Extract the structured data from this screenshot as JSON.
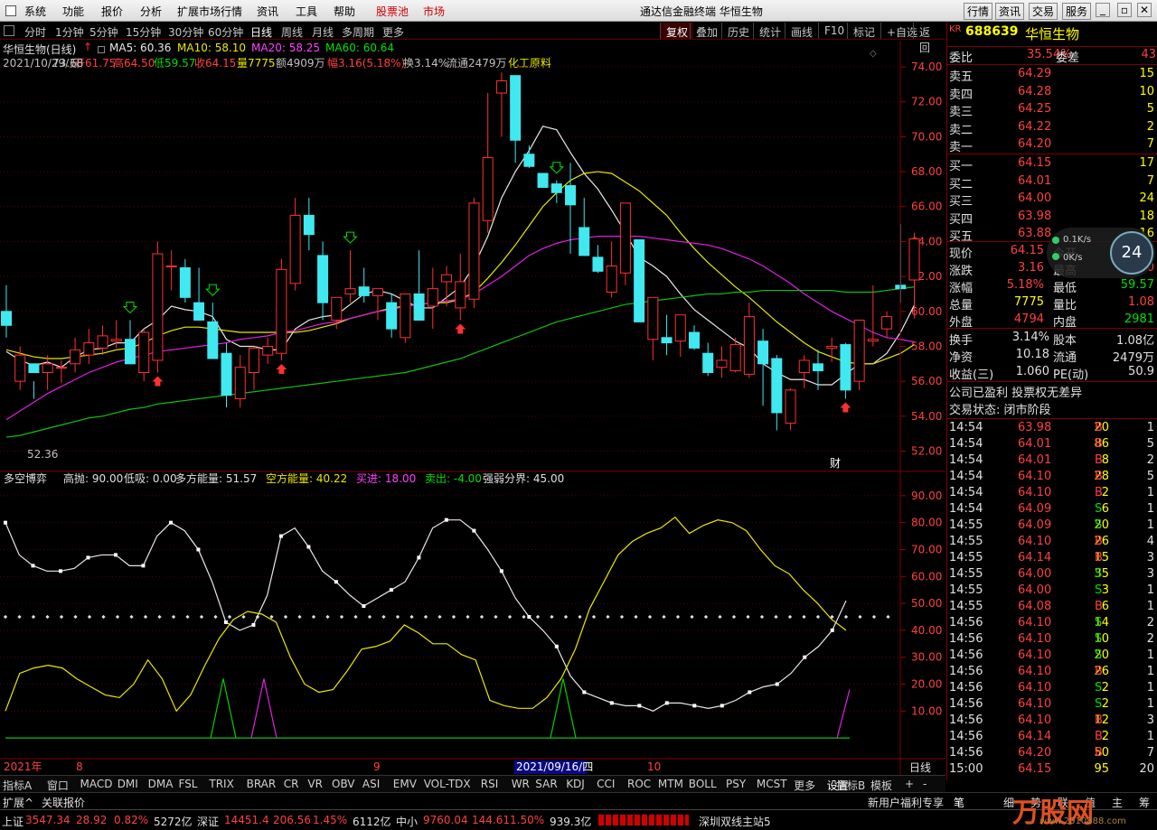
{
  "menu": {
    "items": [
      "系统",
      "功能",
      "报价",
      "分析",
      "扩展市场行情",
      "资讯",
      "工具",
      "帮助"
    ],
    "stockpool": "股票池",
    "market": "市场",
    "title": "通达信金融终端 华恒生物",
    "right_buttons": [
      "行情",
      "资讯",
      "交易",
      "服务"
    ]
  },
  "periods": {
    "items": [
      "分时",
      "1分钟",
      "5分钟",
      "15分钟",
      "30分钟",
      "60分钟",
      "日线",
      "周线",
      "月线",
      "多周期",
      "更多"
    ],
    "active": "日线",
    "right": [
      "复权",
      "叠加",
      "历史",
      "统计",
      "画线",
      "F10",
      "标记",
      "+自选",
      "返回"
    ]
  },
  "info": {
    "name": "华恒生物(日线)",
    "ma5": "MA5: 60.36",
    "ma10": "MA10: 58.10",
    "ma20": "MA20: 58.25",
    "ma60": "MA60: 60.64",
    "date": "2021/10/29/五",
    "open": "开61.75",
    "high": "高64.50",
    "low": "低59.57",
    "close": "收64.15",
    "vol": "量7775",
    "amt": "额4909万",
    "amp": "幅3.16(5.18%)",
    "turn": "换3.14%",
    "float": "流通2479万",
    "industry": "化工原料"
  },
  "indicator": {
    "name": "多空博弈",
    "gp": "高抛: 90.00",
    "dx": "低吸: 0.00",
    "dfnl": "多方能量: 51.57",
    "kfnl": "空方能量: 40.22",
    "mj": "买进: 18.00",
    "mc": "卖出: -4.00",
    "qrfj": "强弱分界: 45.00"
  },
  "price_axis": [
    "74.00",
    "72.00",
    "70.00",
    "68.00",
    "66.00",
    "64.00",
    "62.00",
    "60.00",
    "58.00",
    "56.00",
    "54.00",
    "52.00"
  ],
  "ind_axis": [
    "90.00",
    "80.00",
    "70.00",
    "60.00",
    "50.00",
    "40.00",
    "30.00",
    "20.00",
    "10.00"
  ],
  "annot": {
    "max": "73.68",
    "min": "52.36",
    "cai": "财"
  },
  "date_axis": {
    "y2021": "2021年",
    "m8": "8",
    "m9": "9",
    "sel": "2021/09/16/四",
    "m10": "10",
    "period": "日线"
  },
  "chart_data": {
    "type": "candlestick",
    "symbol": "688639",
    "name": "华恒生物",
    "candles": [
      [
        60,
        61.5,
        58.5,
        59.2
      ],
      [
        56,
        58,
        55.5,
        57.5
      ],
      [
        57,
        56,
        55,
        56.5
      ],
      [
        56.5,
        57.5,
        55.5,
        57
      ],
      [
        56.8,
        57.2,
        55.9,
        56.8
      ],
      [
        57,
        58.5,
        56.5,
        57.8
      ],
      [
        57.5,
        59,
        57,
        58.2
      ],
      [
        57.9,
        59.2,
        57.5,
        58.6
      ],
      [
        58.3,
        59.5,
        57.9,
        58.4
      ],
      [
        58.4,
        59.5,
        57.5,
        57
      ],
      [
        56.5,
        59,
        56,
        58.8
      ],
      [
        57.2,
        64,
        56.5,
        63.3
      ],
      [
        62.6,
        63.5,
        61.2,
        62.6
      ],
      [
        62.5,
        63,
        60.5,
        60.8
      ],
      [
        60.5,
        62.5,
        59.8,
        59.5
      ],
      [
        59.4,
        60.5,
        58.5,
        57.3
      ],
      [
        57.6,
        58.2,
        54.5,
        55.2
      ],
      [
        55,
        57.5,
        54.5,
        56.8
      ],
      [
        56.5,
        58,
        55.5,
        57.9
      ],
      [
        57.5,
        58.5,
        57,
        58
      ],
      [
        57.6,
        63,
        57.2,
        62.4
      ],
      [
        61.6,
        66.5,
        61.2,
        65.5
      ],
      [
        65.5,
        66.5,
        63.5,
        64.4
      ],
      [
        63.2,
        64,
        59.5,
        60.5
      ],
      [
        59.5,
        60.8,
        59,
        60.8
      ],
      [
        61,
        63.5,
        60.5,
        61.3
      ],
      [
        61.4,
        62.5,
        60.5,
        60.9
      ],
      [
        60.9,
        61.2,
        59.5,
        61.3
      ],
      [
        60.5,
        61,
        58.5,
        59
      ],
      [
        58.5,
        61,
        58.2,
        61
      ],
      [
        61,
        63.5,
        59.5,
        59.5
      ],
      [
        60.3,
        62.5,
        59,
        61.3
      ],
      [
        61.7,
        62.6,
        60.3,
        62.1
      ],
      [
        60.2,
        63.3,
        59.5,
        61.7
      ],
      [
        60.7,
        66.5,
        60.2,
        66.2
      ],
      [
        65.2,
        72.5,
        64.5,
        68.8
      ],
      [
        72.5,
        73.68,
        70,
        73.2
      ],
      [
        73.5,
        73.5,
        68.5,
        69.8
      ],
      [
        69,
        69.5,
        68.2,
        68.3
      ],
      [
        67.9,
        67.9,
        67.1,
        67.1
      ],
      [
        67.3,
        67.5,
        66.2,
        66.8
      ],
      [
        67.2,
        68.5,
        63.3,
        66.1
      ],
      [
        64.8,
        66.5,
        63.2,
        63.2
      ],
      [
        63.1,
        63.8,
        62.2,
        62.3
      ],
      [
        61.1,
        64,
        60.8,
        62.6
      ],
      [
        62.2,
        64.5,
        61.5,
        66.2
      ],
      [
        64.1,
        64.1,
        59.4,
        59.4
      ],
      [
        58.4,
        60.8,
        57.2,
        60.8
      ],
      [
        58.5,
        59.8,
        57.5,
        58.2
      ],
      [
        58.3,
        59.5,
        57.4,
        59.8
      ],
      [
        58.8,
        59.2,
        57.8,
        57.9
      ],
      [
        57.6,
        58.2,
        56.3,
        56.5
      ],
      [
        56.8,
        58,
        56.2,
        57.2
      ],
      [
        56.6,
        58.5,
        56.5,
        58.1
      ],
      [
        56.4,
        60.5,
        56.2,
        59.7
      ],
      [
        58.3,
        59,
        54.6,
        57
      ],
      [
        57.3,
        57.5,
        53.2,
        54.2
      ],
      [
        53.6,
        55.6,
        53.2,
        55.5
      ],
      [
        56.5,
        57.5,
        55.6,
        57.2
      ],
      [
        57,
        57.8,
        55.5,
        56.6
      ],
      [
        57.9,
        58.5,
        57.1,
        58
      ],
      [
        58.1,
        58.2,
        55,
        55.5
      ],
      [
        56,
        59.5,
        55.5,
        59.5
      ],
      [
        58.3,
        61.5,
        58,
        58.4
      ],
      [
        59,
        60,
        58.5,
        59.7
      ],
      [
        61.5,
        65,
        60.5,
        61.3
      ],
      [
        61.8,
        64.5,
        59.6,
        64.15
      ]
    ],
    "ma5": [
      57.7,
      57.2,
      56.9,
      57.1,
      56.8,
      57.4,
      57.8,
      57.9,
      58.2,
      58.2,
      59,
      59.5,
      60.3,
      60.1,
      60,
      59.7,
      58.4,
      58,
      58,
      57.8,
      57.8,
      59,
      59.5,
      59.7,
      59.8,
      60.4,
      61,
      61.2,
      61,
      60.6,
      60.2,
      60.2,
      60.8,
      61.4,
      62.6,
      64.3,
      66.5,
      68,
      69.2,
      70.6,
      70.4,
      69.1,
      67.9,
      67,
      65.8,
      64.5,
      63.1,
      62.6,
      62,
      61,
      60.1,
      59.5,
      58.9,
      58.3,
      57.9,
      57,
      56.5,
      56.1,
      56.1,
      55.8,
      55.8,
      56.4,
      57,
      57,
      57.6,
      58.8,
      60.36
    ],
    "ma10": [
      57.8,
      57.6,
      57.4,
      57.3,
      57.3,
      57.4,
      57.5,
      57.6,
      57.8,
      57.9,
      58.2,
      58.6,
      58.9,
      59.1,
      59.1,
      59,
      58.9,
      58.8,
      58.8,
      58.8,
      58.8,
      58.8,
      58.9,
      59.1,
      59.3,
      59.6,
      59.8,
      60,
      60.2,
      60.3,
      60.4,
      60.5,
      60.5,
      60.7,
      61.1,
      61.9,
      62.8,
      63.8,
      64.9,
      66,
      66.8,
      67.5,
      67.9,
      68,
      67.9,
      67.4,
      66.9,
      66.2,
      65.5,
      64.5,
      63.6,
      62.8,
      62.1,
      61.4,
      60.8,
      60.1,
      59.4,
      58.8,
      58.2,
      57.7,
      57.4,
      57.1,
      57,
      57,
      57.3,
      57.6,
      58.1
    ],
    "ma20": [
      53.8,
      54.3,
      54.8,
      55.3,
      55.7,
      56.1,
      56.5,
      56.8,
      57.1,
      57.3,
      57.5,
      57.7,
      57.8,
      57.9,
      58,
      58.1,
      58.2,
      58.4,
      58.5,
      58.6,
      58.8,
      58.9,
      59.1,
      59.3,
      59.4,
      59.6,
      59.8,
      60,
      60.1,
      60.3,
      60.4,
      60.5,
      60.6,
      60.7,
      61,
      61.5,
      62,
      62.6,
      63.2,
      63.6,
      63.9,
      64.1,
      64.2,
      64.3,
      64.3,
      64.3,
      64.3,
      64.2,
      64.1,
      64,
      63.9,
      63.8,
      63.6,
      63.3,
      63,
      62.6,
      62.1,
      61.6,
      61,
      60.5,
      60,
      59.6,
      59.2,
      58.8,
      58.5,
      58.4,
      58.25
    ],
    "ma60": [
      52.8,
      52.9,
      53.1,
      53.3,
      53.5,
      53.7,
      53.9,
      54,
      54.2,
      54.4,
      54.5,
      54.7,
      54.8,
      54.9,
      55,
      55.1,
      55.2,
      55.3,
      55.4,
      55.5,
      55.6,
      55.7,
      55.8,
      55.9,
      56,
      56.1,
      56.2,
      56.3,
      56.4,
      56.5,
      56.7,
      56.9,
      57.1,
      57.3,
      57.6,
      57.9,
      58.2,
      58.5,
      58.8,
      59.1,
      59.4,
      59.6,
      59.8,
      60,
      60.2,
      60.4,
      60.5,
      60.6,
      60.7,
      60.8,
      60.9,
      61,
      61,
      61.1,
      61.1,
      61.2,
      61.2,
      61.2,
      61.2,
      61.2,
      61.2,
      61.1,
      61.1,
      61.1,
      61.2,
      61.3,
      61.4
    ],
    "long": [
      80,
      68,
      64,
      62,
      62,
      63,
      67,
      68,
      68,
      64,
      64,
      75,
      80,
      77,
      70,
      58,
      43,
      40,
      42,
      53,
      75,
      78,
      71,
      62,
      58,
      53,
      49,
      52,
      55,
      58,
      67,
      78,
      81,
      81,
      77,
      70,
      62,
      52,
      45,
      40,
      34,
      23,
      17,
      15,
      13,
      12,
      12,
      10,
      13,
      13,
      12,
      11,
      12,
      14,
      17,
      19,
      20,
      24,
      30,
      34,
      40,
      51
    ],
    "short": [
      10,
      24,
      26,
      27,
      26,
      22,
      19,
      16,
      15,
      20,
      29,
      22,
      10,
      16,
      27,
      37,
      44,
      47,
      46,
      43,
      30,
      20,
      17,
      18,
      25,
      33,
      34,
      36,
      42,
      39,
      35,
      35,
      31,
      29,
      14,
      12,
      11,
      11,
      15,
      22,
      33,
      48,
      58,
      68,
      73,
      76,
      78,
      82,
      76,
      79,
      81,
      80,
      77,
      70,
      64,
      61,
      55,
      50,
      44,
      40
    ]
  },
  "quote": {
    "code": "688639",
    "name": "华恒生物",
    "wb_label": "委比",
    "wb": "35.54%",
    "wc_label": "委差",
    "wc": "43",
    "sells": [
      [
        "卖五",
        "64.29",
        "15"
      ],
      [
        "卖四",
        "64.28",
        "10"
      ],
      [
        "卖三",
        "64.25",
        "5"
      ],
      [
        "卖二",
        "64.22",
        "2"
      ],
      [
        "卖一",
        "64.20",
        "7"
      ]
    ],
    "buys": [
      [
        "买一",
        "64.15",
        "17"
      ],
      [
        "买二",
        "64.01",
        "7"
      ],
      [
        "买三",
        "64.00",
        "24"
      ],
      [
        "买四",
        "63.98",
        "18"
      ],
      [
        "买五",
        "63.88",
        "16"
      ]
    ],
    "stats": [
      [
        "现价",
        "64.15",
        "今开",
        "61.75"
      ],
      [
        "涨跌",
        "3.16",
        "最高",
        "64.50"
      ],
      [
        "涨幅",
        "5.18%",
        "最低",
        "59.57"
      ],
      [
        "总量",
        "7775",
        "量比",
        "1.08"
      ],
      [
        "外盘",
        "4794",
        "内盘",
        "2981"
      ]
    ],
    "stats2": [
      [
        "换手",
        "3.14%",
        "股本",
        "1.08亿"
      ],
      [
        "净资",
        "10.18",
        "流通",
        "2479万"
      ],
      [
        "收益(三)",
        "1.060",
        "PE(动)",
        "50.9"
      ]
    ],
    "profit": "公司已盈利 投票权无差异",
    "trade_state": "交易状态: 闭市阶段",
    "ticks": [
      [
        "14:54",
        "63.98",
        "20",
        "B",
        "1"
      ],
      [
        "14:54",
        "64.01",
        "86",
        "B",
        "5"
      ],
      [
        "14:54",
        "64.01",
        "8",
        "B",
        "2"
      ],
      [
        "14:54",
        "64.10",
        "28",
        "B",
        "5"
      ],
      [
        "14:54",
        "64.10",
        "2",
        "B",
        "1"
      ],
      [
        "14:54",
        "64.09",
        "6",
        "S",
        "1"
      ],
      [
        "14:55",
        "64.09",
        "20",
        "S",
        "1"
      ],
      [
        "14:55",
        "64.10",
        "26",
        "B",
        "4"
      ],
      [
        "14:55",
        "64.14",
        "15",
        "B",
        "3"
      ],
      [
        "14:55",
        "64.00",
        "35",
        "S",
        "3"
      ],
      [
        "14:55",
        "64.00",
        "3",
        "S",
        "1"
      ],
      [
        "14:55",
        "64.08",
        "6",
        "B",
        "1"
      ],
      [
        "14:56",
        "64.10",
        "14",
        "S",
        "2"
      ],
      [
        "14:56",
        "64.10",
        "10",
        "S",
        "2"
      ],
      [
        "14:56",
        "64.10",
        "20",
        "S",
        "1"
      ],
      [
        "14:56",
        "64.10",
        "26",
        "B",
        "1"
      ],
      [
        "14:56",
        "64.10",
        "2",
        "S",
        "1"
      ],
      [
        "14:56",
        "64.10",
        "2",
        "S",
        "1"
      ],
      [
        "14:56",
        "64.10",
        "12",
        "B",
        "3"
      ],
      [
        "14:56",
        "64.14",
        "2",
        "B",
        "1"
      ],
      [
        "14:56",
        "64.20",
        "50",
        "B",
        "7"
      ],
      [
        "15:00",
        "64.15",
        "95",
        "",
        "20"
      ]
    ],
    "speed1": "0.1K/s",
    "speed2": "0K/s",
    "pct": "24"
  },
  "tabs": {
    "items": [
      "指标A",
      "窗口",
      "MACD",
      "DMI",
      "DMA",
      "FSL",
      "TRIX",
      "BRAR",
      "CR",
      "VR",
      "OBV",
      "ASI",
      "EMV",
      "VOL-TDX",
      "RSI",
      "WR",
      "SAR",
      "KDJ",
      "CCI",
      "ROC",
      "MTM",
      "BOLL",
      "PSY",
      "MCST",
      "更多",
      "设置"
    ],
    "right": [
      "指标B",
      "模板",
      "+",
      "-"
    ]
  },
  "bot2": {
    "a": "扩展^",
    "b": "关联报价",
    "c": "新用户福利专享",
    "d": "笔",
    "e": "细",
    "f": "势",
    "g": "联",
    "h": "值",
    "i": "主",
    "j": "筹"
  },
  "status": {
    "sh": "上证",
    "sh_val": "3547.34",
    "sh_ch": "28.92",
    "sh_pct": "0.82%",
    "sh_amt": "5272亿",
    "sz": "深证",
    "sz_val": "14451.4",
    "sz_ch": "206.56",
    "sz_pct": "1.45%",
    "sz_amt": "6112亿",
    "zx": "中小",
    "zx_val": "9760.04",
    "zx_ch": "144.61",
    "zx_pct": "1.50%",
    "zx_amt": "939.3亿",
    "server": "深圳双线主站5",
    "wm": "万股网",
    "wm_url": "www.2010888.com"
  }
}
